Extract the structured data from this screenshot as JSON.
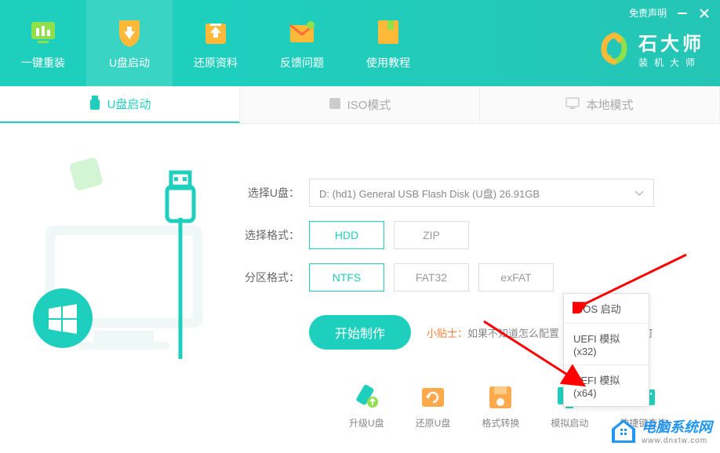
{
  "header": {
    "disclaimer": "免责声明",
    "nav": [
      {
        "label": "一键重装"
      },
      {
        "label": "U盘启动"
      },
      {
        "label": "还原资料"
      },
      {
        "label": "反馈问题"
      },
      {
        "label": "使用教程"
      }
    ],
    "brand_title": "石大师",
    "brand_sub": "装机大师"
  },
  "tabs": [
    {
      "label": "U盘启动",
      "active": true
    },
    {
      "label": "ISO模式",
      "active": false
    },
    {
      "label": "本地模式",
      "active": false
    }
  ],
  "form": {
    "disk_label": "选择U盘：",
    "disk_value": "D: (hd1) General USB Flash Disk  (U盘) 26.91GB",
    "format_label": "选择格式：",
    "format_options": [
      "HDD",
      "ZIP"
    ],
    "format_selected": "HDD",
    "partition_label": "分区格式：",
    "partition_options": [
      "NTFS",
      "FAT32",
      "exFAT"
    ],
    "partition_selected": "NTFS",
    "start_btn": "开始制作",
    "tip_label": "小贴士：",
    "tip_text": "如果不知道怎么配置",
    "tip_suffix": "即可"
  },
  "dropdown": {
    "items": [
      "BIOS 启动",
      "UEFI 模拟(x32)",
      "UEFI 模拟(x64)"
    ]
  },
  "tools": [
    {
      "label": "升级U盘",
      "color": "#1fcfbe"
    },
    {
      "label": "还原U盘",
      "color": "#ffa94d"
    },
    {
      "label": "格式转换",
      "color": "#ffa94d"
    },
    {
      "label": "模拟启动",
      "color": "#1fcfbe"
    },
    {
      "label": "快捷键查询",
      "color": "#1fcfbe"
    }
  ],
  "watermark": {
    "title": "电脑系统网",
    "url": "www.dnxtw.com"
  }
}
